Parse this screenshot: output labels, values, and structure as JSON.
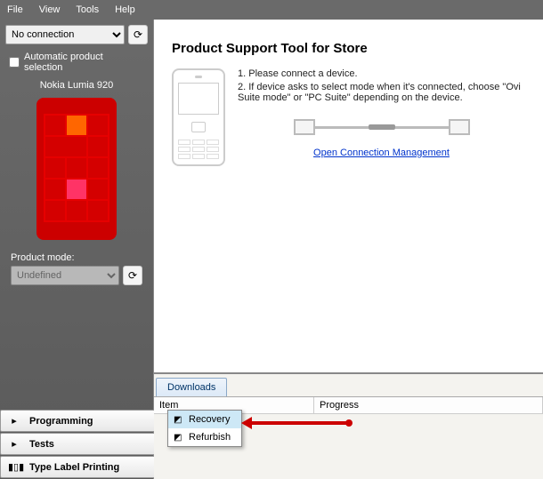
{
  "menubar": {
    "file": "File",
    "view": "View",
    "tools": "Tools",
    "help": "Help"
  },
  "sidebar": {
    "connection": {
      "value": "No connection"
    },
    "auto_label": "Automatic product selection",
    "product_name": "Nokia Lumia 920",
    "mode_label": "Product mode:",
    "mode_value": "Undefined",
    "buttons": {
      "programming": "Programming",
      "tests": "Tests",
      "printing": "Type Label Printing"
    }
  },
  "content": {
    "title": "Product Support Tool for Store",
    "step1": "1. Please connect a device.",
    "step2": "2. If device asks to select mode when it's connected, choose \"Ovi Suite mode\" or \"PC Suite\" depending on the device.",
    "link": "Open Connection Management"
  },
  "lower": {
    "tab": "Downloads",
    "col_item": "Item",
    "col_progress": "Progress"
  },
  "context": {
    "recovery": "Recovery",
    "refurbish": "Refurbish"
  }
}
